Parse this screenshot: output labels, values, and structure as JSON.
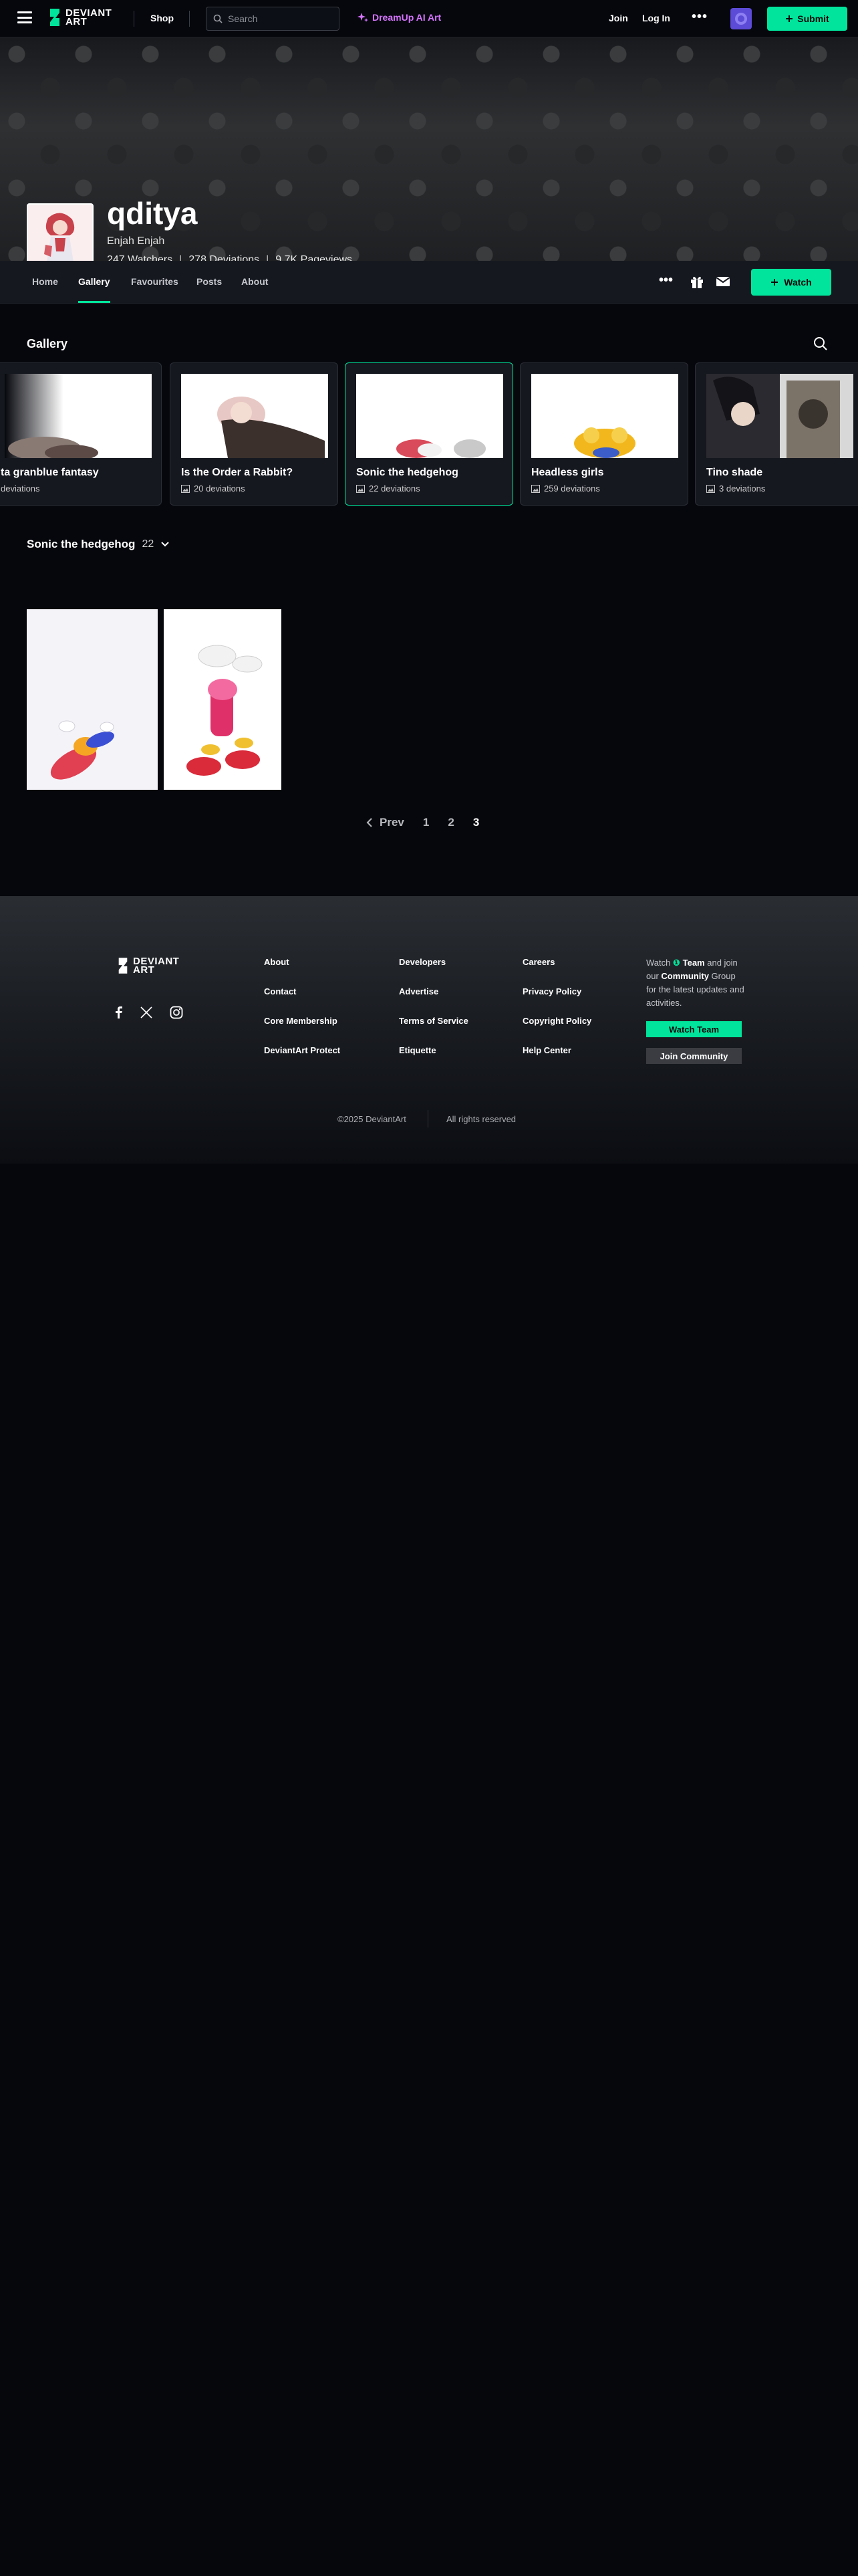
{
  "topbar": {
    "logo_line1": "DEVIANT",
    "logo_line2": "ART",
    "shop": "Shop",
    "search_placeholder": "Search",
    "dreamup": "DreamUp AI Art",
    "join": "Join",
    "login": "Log In",
    "more": "•••",
    "submit": "Submit"
  },
  "profile": {
    "username": "qditya",
    "real_name": "Enjah Enjah",
    "watchers": "247 Watchers",
    "deviations": "278 Deviations",
    "pageviews": "9.7K Pageviews",
    "separator": "|"
  },
  "tabs": [
    "Home",
    "Gallery",
    "Favourites",
    "Posts",
    "About"
  ],
  "subnav": {
    "more": "•••",
    "watch": "Watch"
  },
  "gallery": {
    "title": "Gallery",
    "folders": [
      {
        "name": "ta granblue fantasy",
        "count": "deviations"
      },
      {
        "name": "Is the Order a Rabbit?",
        "count": "20 deviations"
      },
      {
        "name": "Sonic the hedgehog",
        "count": "22 deviations"
      },
      {
        "name": "Headless girls",
        "count": "259 deviations"
      },
      {
        "name": "Tino shade",
        "count": "3 deviations"
      }
    ],
    "current_folder": "Sonic the hedgehog",
    "current_count": "22"
  },
  "pagination": {
    "prev": "Prev",
    "pages": [
      "1",
      "2",
      "3"
    ],
    "current": "3"
  },
  "footer": {
    "logo_line1": "DEVIANT",
    "logo_line2": "ART",
    "col1": [
      "About",
      "Contact",
      "Core Membership",
      "DeviantArt Protect"
    ],
    "col2": [
      "Developers",
      "Advertise",
      "Terms of Service",
      "Etiquette"
    ],
    "col3": [
      "Careers",
      "Privacy Policy",
      "Copyright Policy",
      "Help Center"
    ],
    "promo_watch": "Watch",
    "promo_team": "Team",
    "promo_and": "and join our",
    "promo_community": "Community",
    "promo_rest": "Group for the latest updates and activities.",
    "watch_team": "Watch Team",
    "join_community": "Join Community",
    "copyright": "©2025 DeviantArt",
    "rights": "All rights reserved"
  },
  "colors": {
    "accent": "#00e59b",
    "dreamup": "#d674ff",
    "background": "#06070d"
  }
}
